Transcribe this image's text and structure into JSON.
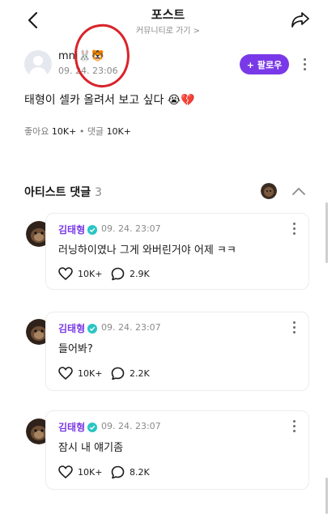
{
  "header": {
    "title": "포스트",
    "subtitle": "커뮤니티로 가기 >"
  },
  "post": {
    "author_name": "mni🐰🐯",
    "time": "09. 24. 23:06",
    "follow_label": "+ 팔로우",
    "text": "태형이 셀카 올려서 보고 싶다 😭💔",
    "likes_label": "좋아요",
    "likes_value": "10K+",
    "comments_label": "댓글",
    "comments_value": "10K+",
    "separator": "•"
  },
  "artist_comments": {
    "title": "아티스트 댓글",
    "count": "3",
    "items": [
      {
        "name": "김태형",
        "time": "09. 24. 23:07",
        "text": "러닝하이였나 그게 와버린거야 어제 ㅋㅋ",
        "likes": "10K+",
        "replies": "2.9K"
      },
      {
        "name": "김태형",
        "time": "09. 24. 23:07",
        "text": "들어봐?",
        "likes": "10K+",
        "replies": "2.2K"
      },
      {
        "name": "김태형",
        "time": "09. 24. 23:07",
        "text": "잠시 내 얘기좀",
        "likes": "10K+",
        "replies": "8.2K"
      }
    ]
  },
  "colors": {
    "accent": "#7a39e8",
    "verified": "#2bc4c4",
    "annotation": "#d8232a"
  },
  "icons": [
    "back-arrow-icon",
    "share-icon",
    "more-vertical-icon",
    "heart-icon",
    "comment-bubble-icon",
    "chevron-up-icon",
    "verified-badge-icon"
  ]
}
